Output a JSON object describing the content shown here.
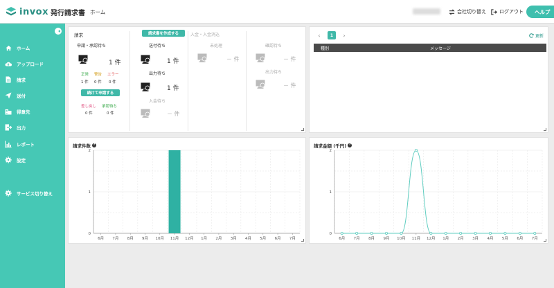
{
  "header": {
    "logo_text": "invox",
    "logo_sub": "発行請求書",
    "home": "ホーム",
    "switch_company": "会社切り替え",
    "logout": "ログアウト",
    "help": "ヘルプ"
  },
  "sidebar": {
    "items": [
      {
        "label": "ホーム",
        "icon": "home-icon"
      },
      {
        "label": "アップロード",
        "icon": "cloud-upload-icon"
      },
      {
        "label": "請求",
        "icon": "document-icon"
      },
      {
        "label": "送付",
        "icon": "send-icon"
      },
      {
        "label": "得意先",
        "icon": "building-icon"
      },
      {
        "label": "出力",
        "icon": "export-icon"
      },
      {
        "label": "レポート",
        "icon": "report-icon"
      },
      {
        "label": "設定",
        "icon": "gear-icon"
      }
    ],
    "service_switch": "サービス切り替え"
  },
  "billing": {
    "title": "請求",
    "create_button": "請求書を作成する",
    "payment_reconcile": "入金・入金消込",
    "pending_approval": {
      "label": "申請・承認待ち",
      "count": "1 件"
    },
    "status_labels": {
      "normal": "正常",
      "warning": "警告",
      "error": "エラー"
    },
    "status_counts": {
      "normal": "1 件",
      "warning": "0 件",
      "error": "0 件"
    },
    "continue_button": "続けて申請する",
    "returned": {
      "label": "差し戻し",
      "count": "0 件"
    },
    "approval_wait": {
      "label": "承認待ち",
      "count": "0 件"
    },
    "send_wait": {
      "label": "送付待ち",
      "count": "1 件"
    },
    "output_wait": {
      "label": "出力待ち",
      "count": "1 件"
    },
    "payment_wait": {
      "label": "入金待ち",
      "count": "－ 件"
    },
    "unprocessed": {
      "label": "未処理",
      "count": "－ 件"
    },
    "confirm_wait": {
      "label": "確認待ち",
      "count": "－ 件"
    },
    "output_wait2": {
      "label": "出力待ち",
      "count": "－ 件"
    }
  },
  "messages": {
    "page": "1",
    "refresh": "更新",
    "col_type": "種別",
    "col_message": "メッセージ"
  },
  "charts": {
    "count_title": "請求件数",
    "amount_title": "請求金額 (千円)"
  },
  "chart_data": [
    {
      "type": "bar",
      "title": "請求件数",
      "categories": [
        "6月",
        "7月",
        "8月",
        "9月",
        "10月",
        "11月",
        "12月",
        "1月",
        "2月",
        "3月",
        "4月",
        "5月",
        "6月",
        "7月"
      ],
      "values": [
        0,
        0,
        0,
        0,
        0,
        2,
        0,
        0,
        0,
        0,
        0,
        0,
        0,
        0
      ],
      "ylim": [
        0,
        2
      ],
      "yticks": [
        "0",
        "1",
        "2"
      ],
      "color": "#2fb1a3"
    },
    {
      "type": "line",
      "title": "請求金額 (千円)",
      "categories": [
        "6月",
        "7月",
        "8月",
        "9月",
        "10月",
        "11月",
        "12月",
        "1月",
        "2月",
        "3月",
        "4月",
        "5月",
        "6月",
        "7月"
      ],
      "values": [
        0,
        0,
        0,
        0,
        0,
        2,
        0,
        0,
        0,
        0,
        0,
        0,
        0,
        0
      ],
      "ylim": [
        0,
        2
      ],
      "yticks": [
        "0",
        "1",
        "2"
      ],
      "color": "#5fcdc0"
    }
  ]
}
